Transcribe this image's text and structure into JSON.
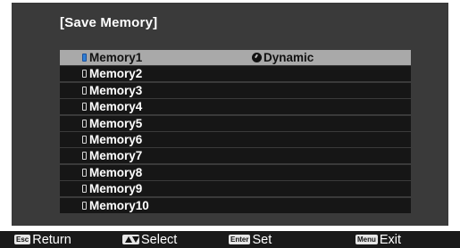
{
  "title": "[Save Memory]",
  "memories": [
    {
      "label": "Memory1",
      "mode": "Dynamic"
    },
    {
      "label": "Memory2",
      "mode": ""
    },
    {
      "label": "Memory3",
      "mode": ""
    },
    {
      "label": "Memory4",
      "mode": ""
    },
    {
      "label": "Memory5",
      "mode": ""
    },
    {
      "label": "Memory6",
      "mode": ""
    },
    {
      "label": "Memory7",
      "mode": ""
    },
    {
      "label": "Memory8",
      "mode": ""
    },
    {
      "label": "Memory9",
      "mode": ""
    },
    {
      "label": "Memory10",
      "mode": ""
    }
  ],
  "selected_index": 0,
  "footer": {
    "return": {
      "key": "Esc",
      "label": "Return"
    },
    "select": {
      "key_icon": "up-down-arrow-icon",
      "label": "Select"
    },
    "set": {
      "key": "Enter",
      "label": "Set"
    },
    "exit": {
      "key": "Menu",
      "label": "Exit"
    }
  },
  "colors": {
    "panel": "#3a3a3a",
    "row": "#161616",
    "row_selected": "#a9a9a9",
    "memory_icon_selected": "#2f7fd6",
    "footer": "#1a1a1a"
  }
}
